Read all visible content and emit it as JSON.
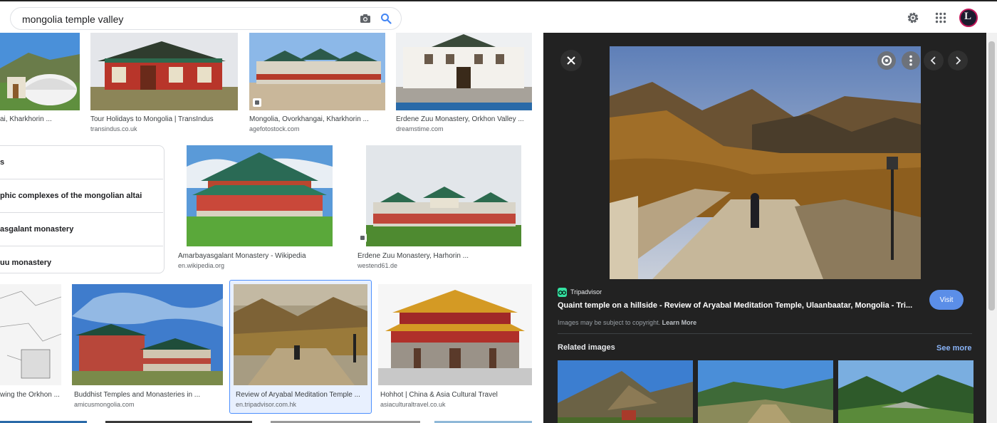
{
  "search": {
    "query": "mongolia temple valley"
  },
  "header": {
    "avatar_letter": "L"
  },
  "grid": {
    "row1": [
      {
        "title": "ai, Kharkhorin ...",
        "source": ""
      },
      {
        "title": "Tour Holidays to Mongolia | TransIndus",
        "source": "transindus.co.uk"
      },
      {
        "title": "Mongolia, Ovorkhangai, Kharkhorin ...",
        "source": "agefotostock.com"
      },
      {
        "title": "Erdene Zuu Monastery, Orkhon Valley ...",
        "source": "dreamstime.com"
      }
    ],
    "row2": [
      {
        "title": "Amarbayasgalant Monastery - Wikipedia",
        "source": "en.wikipedia.org"
      },
      {
        "title": "Erdene Zuu Monastery, Harhorin ...",
        "source": "westend61.de"
      }
    ],
    "row3": [
      {
        "title": "wing the Orkhon ...",
        "source": ""
      },
      {
        "title": "Buddhist Temples and Monasteries in ...",
        "source": "amicusmongolia.com"
      },
      {
        "title": "Review of Aryabal Meditation Temple ...",
        "source": "en.tripadvisor.com.hk"
      },
      {
        "title": "Hohhot | China & Asia Cultural Travel",
        "source": "asiaculturaltravel.co.uk"
      }
    ]
  },
  "related_searches": {
    "heading": "s",
    "items": [
      "phic complexes of the mongolian altai",
      "asgalant monastery",
      "uu monastery"
    ]
  },
  "preview": {
    "site_name": "Tripadvisor",
    "title": "Quaint temple on a hillside - Review of Aryabal Meditation Temple, Ulaanbaatar, Mongolia - Tri...",
    "copyright_text": "Images may be subject to copyright.",
    "learn_more": "Learn More",
    "visit_label": "Visit",
    "related_heading": "Related images",
    "see_more": "See more"
  },
  "colors": {
    "accent_blue": "#1a73e8",
    "panel_bg": "#222222",
    "visit_button": "#5b8ee8",
    "see_more": "#8ab4f8"
  }
}
